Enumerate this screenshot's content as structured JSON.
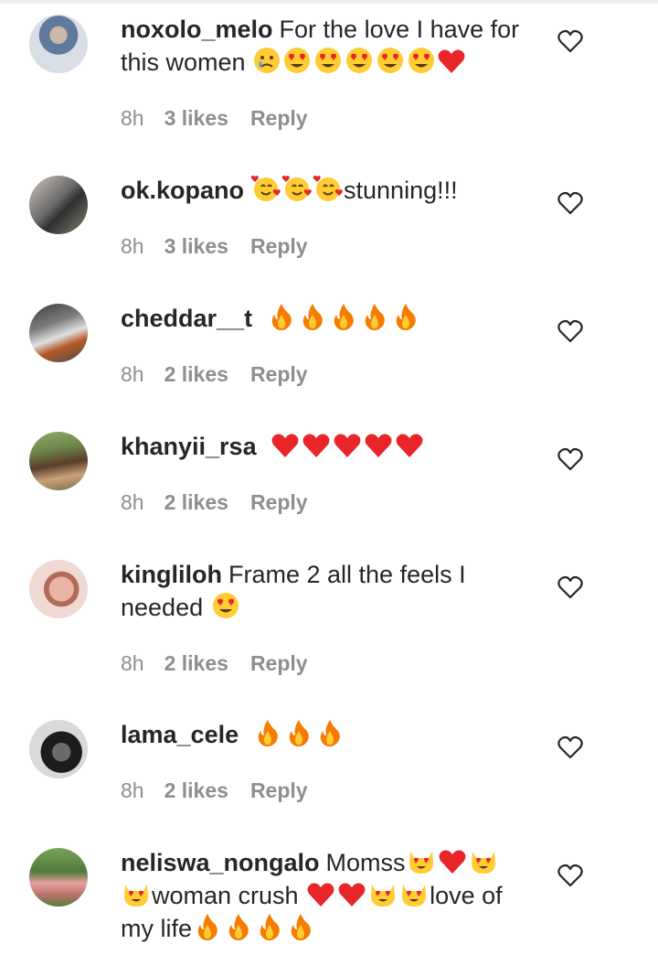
{
  "comments": [
    {
      "username": "noxolo_melo",
      "text": "For the love I have for this women",
      "emojis": [
        "crying-face",
        "heart-eyes",
        "heart-eyes",
        "heart-eyes",
        "heart-eyes",
        "heart-eyes",
        "red-heart"
      ],
      "time": "8h",
      "likes": "3 likes",
      "reply": "Reply"
    },
    {
      "username": "ok.kopano",
      "text": "stunning!!!",
      "emojis": [
        "smiling-face-with-hearts",
        "smiling-face-with-hearts",
        "smiling-face-with-hearts"
      ],
      "time": "8h",
      "likes": "3 likes",
      "reply": "Reply"
    },
    {
      "username": "cheddar__t",
      "text": "",
      "emojis": [
        "fire",
        "fire",
        "fire",
        "fire",
        "fire"
      ],
      "time": "8h",
      "likes": "2 likes",
      "reply": "Reply"
    },
    {
      "username": "khanyii_rsa",
      "text": "",
      "emojis": [
        "red-heart",
        "red-heart",
        "red-heart",
        "red-heart",
        "red-heart"
      ],
      "time": "8h",
      "likes": "2 likes",
      "reply": "Reply"
    },
    {
      "username": "kingliloh",
      "text": "Frame 2 all the feels I needed",
      "emojis": [
        "heart-eyes"
      ],
      "time": "8h",
      "likes": "2 likes",
      "reply": "Reply"
    },
    {
      "username": "lama_cele",
      "text": "",
      "emojis": [
        "fire",
        "fire",
        "fire"
      ],
      "time": "8h",
      "likes": "2 likes",
      "reply": "Reply"
    },
    {
      "username": "neliswa_nongalo",
      "text_parts": [
        "Momss",
        "woman crush",
        "love of my life"
      ],
      "emojis": [
        "heart-eyes-cat",
        "red-heart",
        "heart-eyes-cat",
        "heart-eyes-cat",
        "red-heart",
        "red-heart",
        "heart-eyes-cat",
        "heart-eyes-cat",
        "fire",
        "fire",
        "fire",
        "fire"
      ]
    }
  ],
  "colors": {
    "text": "#262626",
    "meta": "#8e8e8e",
    "heart": "#e8262a",
    "fire": "#f57c00"
  }
}
